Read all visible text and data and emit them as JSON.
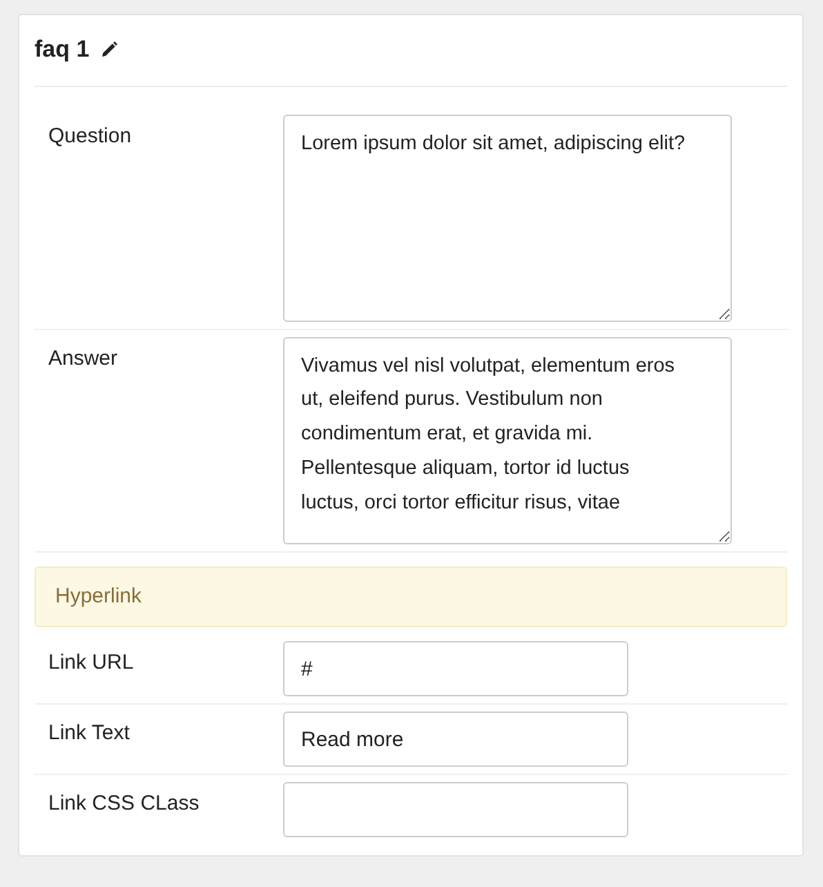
{
  "title": "faq 1",
  "sections": [
    {
      "kind": "textarea",
      "label": "Question",
      "value": "Lorem ipsum dolor sit amet, adipiscing elit?"
    },
    {
      "kind": "textarea",
      "label": "Answer",
      "value": "Vivamus vel nisl volutpat, elementum eros ut, eleifend purus. Vestibulum non condimentum erat, et gravida mi. Pellentesque aliquam, tortor id luctus luctus, orci tortor efficitur risus, vitae"
    },
    {
      "kind": "heading",
      "label": "Hyperlink"
    },
    {
      "kind": "input",
      "label": "Link URL",
      "value": "#"
    },
    {
      "kind": "input",
      "label": "Link Text",
      "value": "Read more"
    },
    {
      "kind": "input",
      "label": "Link CSS CLass"
    }
  ]
}
